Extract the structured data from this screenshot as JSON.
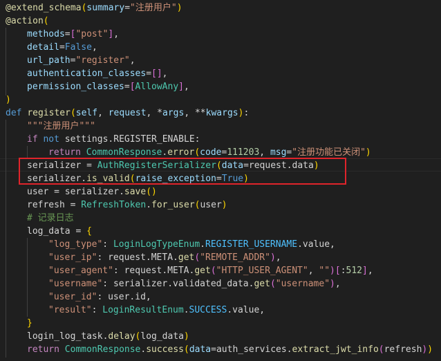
{
  "editor": {
    "language": "python",
    "lines": [
      {
        "indent": 0,
        "tokens": [
          [
            "deco",
            "@extend_schema"
          ],
          [
            "paren",
            "("
          ],
          [
            "param",
            "summary"
          ],
          [
            "plain",
            "="
          ],
          [
            "str",
            "\"注册用户\""
          ],
          [
            "paren",
            ")"
          ]
        ]
      },
      {
        "indent": 0,
        "tokens": [
          [
            "deco",
            "@action"
          ],
          [
            "paren",
            "("
          ]
        ]
      },
      {
        "indent": 1,
        "tokens": [
          [
            "param",
            "methods"
          ],
          [
            "plain",
            "="
          ],
          [
            "brack",
            "["
          ],
          [
            "str",
            "\"post\""
          ],
          [
            "brack",
            "]"
          ],
          [
            "plain",
            ","
          ]
        ]
      },
      {
        "indent": 1,
        "tokens": [
          [
            "param",
            "detail"
          ],
          [
            "plain",
            "="
          ],
          [
            "kw",
            "False"
          ],
          [
            "plain",
            ","
          ]
        ]
      },
      {
        "indent": 1,
        "tokens": [
          [
            "param",
            "url_path"
          ],
          [
            "plain",
            "="
          ],
          [
            "str",
            "\"register\""
          ],
          [
            "plain",
            ","
          ]
        ]
      },
      {
        "indent": 1,
        "tokens": [
          [
            "param",
            "authentication_classes"
          ],
          [
            "plain",
            "="
          ],
          [
            "brack",
            "[]"
          ],
          [
            "plain",
            ","
          ]
        ]
      },
      {
        "indent": 1,
        "tokens": [
          [
            "param",
            "permission_classes"
          ],
          [
            "plain",
            "="
          ],
          [
            "brack",
            "["
          ],
          [
            "class",
            "AllowAny"
          ],
          [
            "brack",
            "]"
          ],
          [
            "plain",
            ","
          ]
        ]
      },
      {
        "indent": 0,
        "tokens": [
          [
            "paren",
            ")"
          ]
        ]
      },
      {
        "indent": 0,
        "tokens": [
          [
            "kw",
            "def "
          ],
          [
            "fn",
            "register"
          ],
          [
            "paren",
            "("
          ],
          [
            "param",
            "self"
          ],
          [
            "plain",
            ", "
          ],
          [
            "param",
            "request"
          ],
          [
            "plain",
            ", *"
          ],
          [
            "param",
            "args"
          ],
          [
            "plain",
            ", **"
          ],
          [
            "param",
            "kwargs"
          ],
          [
            "paren",
            ")"
          ],
          [
            "plain",
            ":"
          ]
        ]
      },
      {
        "indent": 1,
        "tokens": [
          [
            "str",
            "\"\"\"注册用户\"\"\""
          ]
        ]
      },
      {
        "indent": 1,
        "tokens": [
          [
            "ctrl",
            "if "
          ],
          [
            "kw",
            "not "
          ],
          [
            "ivar",
            "settings"
          ],
          [
            "plain",
            "."
          ],
          [
            "ivar",
            "REGISTER_ENABLE"
          ],
          [
            "plain",
            ":"
          ]
        ]
      },
      {
        "indent": 2,
        "tokens": [
          [
            "ctrl",
            "return "
          ],
          [
            "class",
            "CommonResponse"
          ],
          [
            "plain",
            "."
          ],
          [
            "fn",
            "error"
          ],
          [
            "paren",
            "("
          ],
          [
            "param",
            "code"
          ],
          [
            "plain",
            "="
          ],
          [
            "num",
            "111203"
          ],
          [
            "plain",
            ", "
          ],
          [
            "param",
            "msg"
          ],
          [
            "plain",
            "="
          ],
          [
            "str",
            "\"注册功能已关闭\""
          ],
          [
            "paren",
            ")"
          ]
        ]
      },
      {
        "indent": 1,
        "tokens": [
          [
            "ivar",
            "serializer "
          ],
          [
            "plain",
            "= "
          ],
          [
            "class",
            "AuthRegisterSerializer"
          ],
          [
            "paren",
            "("
          ],
          [
            "param",
            "data"
          ],
          [
            "plain",
            "="
          ],
          [
            "ivar",
            "request"
          ],
          [
            "plain",
            "."
          ],
          [
            "ivar",
            "data"
          ],
          [
            "paren",
            ")"
          ]
        ]
      },
      {
        "indent": 1,
        "tokens": [
          [
            "ivar",
            "serializer"
          ],
          [
            "plain",
            "."
          ],
          [
            "fn",
            "is_valid"
          ],
          [
            "paren",
            "("
          ],
          [
            "param",
            "raise_exception"
          ],
          [
            "plain",
            "="
          ],
          [
            "kw",
            "True"
          ],
          [
            "paren",
            ")"
          ]
        ]
      },
      {
        "indent": 1,
        "tokens": [
          [
            "ivar",
            "user "
          ],
          [
            "plain",
            "= "
          ],
          [
            "ivar",
            "serializer"
          ],
          [
            "plain",
            "."
          ],
          [
            "fn",
            "save"
          ],
          [
            "paren",
            "()"
          ]
        ]
      },
      {
        "indent": 1,
        "tokens": [
          [
            "ivar",
            "refresh "
          ],
          [
            "plain",
            "= "
          ],
          [
            "class",
            "RefreshToken"
          ],
          [
            "plain",
            "."
          ],
          [
            "fn",
            "for_user"
          ],
          [
            "paren",
            "("
          ],
          [
            "ivar",
            "user"
          ],
          [
            "paren",
            ")"
          ]
        ]
      },
      {
        "indent": 1,
        "tokens": [
          [
            "comment",
            "# 记录日志"
          ]
        ]
      },
      {
        "indent": 1,
        "tokens": [
          [
            "ivar",
            "log_data "
          ],
          [
            "plain",
            "= "
          ],
          [
            "paren",
            "{"
          ]
        ]
      },
      {
        "indent": 2,
        "tokens": [
          [
            "str",
            "\"log_type\""
          ],
          [
            "plain",
            ": "
          ],
          [
            "class",
            "LoginLogTypeEnum"
          ],
          [
            "plain",
            "."
          ],
          [
            "const",
            "REGISTER_USERNAME"
          ],
          [
            "plain",
            "."
          ],
          [
            "ivar",
            "value"
          ],
          [
            "plain",
            ","
          ]
        ]
      },
      {
        "indent": 2,
        "tokens": [
          [
            "str",
            "\"user_ip\""
          ],
          [
            "plain",
            ": "
          ],
          [
            "ivar",
            "request"
          ],
          [
            "plain",
            "."
          ],
          [
            "ivar",
            "META"
          ],
          [
            "plain",
            "."
          ],
          [
            "fn",
            "get"
          ],
          [
            "brack",
            "("
          ],
          [
            "str",
            "\"REMOTE_ADDR\""
          ],
          [
            "brack",
            ")"
          ],
          [
            "plain",
            ","
          ]
        ]
      },
      {
        "indent": 2,
        "tokens": [
          [
            "str",
            "\"user_agent\""
          ],
          [
            "plain",
            ": "
          ],
          [
            "ivar",
            "request"
          ],
          [
            "plain",
            "."
          ],
          [
            "ivar",
            "META"
          ],
          [
            "plain",
            "."
          ],
          [
            "fn",
            "get"
          ],
          [
            "brack",
            "("
          ],
          [
            "str",
            "\"HTTP_USER_AGENT\""
          ],
          [
            "plain",
            ", "
          ],
          [
            "str",
            "\"\""
          ],
          [
            "brack",
            ")"
          ],
          [
            "brack",
            "["
          ],
          [
            "plain",
            ":"
          ],
          [
            "num",
            "512"
          ],
          [
            "brack",
            "]"
          ],
          [
            "plain",
            ","
          ]
        ]
      },
      {
        "indent": 2,
        "tokens": [
          [
            "str",
            "\"username\""
          ],
          [
            "plain",
            ": "
          ],
          [
            "ivar",
            "serializer"
          ],
          [
            "plain",
            "."
          ],
          [
            "ivar",
            "validated_data"
          ],
          [
            "plain",
            "."
          ],
          [
            "fn",
            "get"
          ],
          [
            "brack",
            "("
          ],
          [
            "str",
            "\"username\""
          ],
          [
            "brack",
            ")"
          ],
          [
            "plain",
            ","
          ]
        ]
      },
      {
        "indent": 2,
        "tokens": [
          [
            "str",
            "\"user_id\""
          ],
          [
            "plain",
            ": "
          ],
          [
            "ivar",
            "user"
          ],
          [
            "plain",
            "."
          ],
          [
            "ivar",
            "id"
          ],
          [
            "plain",
            ","
          ]
        ]
      },
      {
        "indent": 2,
        "tokens": [
          [
            "str",
            "\"result\""
          ],
          [
            "plain",
            ": "
          ],
          [
            "class",
            "LoginResultEnum"
          ],
          [
            "plain",
            "."
          ],
          [
            "const",
            "SUCCESS"
          ],
          [
            "plain",
            "."
          ],
          [
            "ivar",
            "value"
          ],
          [
            "plain",
            ","
          ]
        ]
      },
      {
        "indent": 1,
        "tokens": [
          [
            "paren",
            "}"
          ]
        ]
      },
      {
        "indent": 1,
        "tokens": [
          [
            "ivar",
            "login_log_task"
          ],
          [
            "plain",
            "."
          ],
          [
            "fn",
            "delay"
          ],
          [
            "paren",
            "("
          ],
          [
            "ivar",
            "log_data"
          ],
          [
            "paren",
            ")"
          ]
        ]
      },
      {
        "indent": 1,
        "tokens": [
          [
            "ctrl",
            "return "
          ],
          [
            "class",
            "CommonResponse"
          ],
          [
            "plain",
            "."
          ],
          [
            "fn",
            "success"
          ],
          [
            "paren",
            "("
          ],
          [
            "param",
            "data"
          ],
          [
            "plain",
            "="
          ],
          [
            "ivar",
            "auth_services"
          ],
          [
            "plain",
            "."
          ],
          [
            "fn",
            "extract_jwt_info"
          ],
          [
            "brack",
            "("
          ],
          [
            "ivar",
            "refresh"
          ],
          [
            "brack",
            ")"
          ],
          [
            "paren",
            ")"
          ]
        ]
      }
    ],
    "highlight_lines": [
      12,
      13
    ],
    "highlight_color": "#e0242b"
  }
}
